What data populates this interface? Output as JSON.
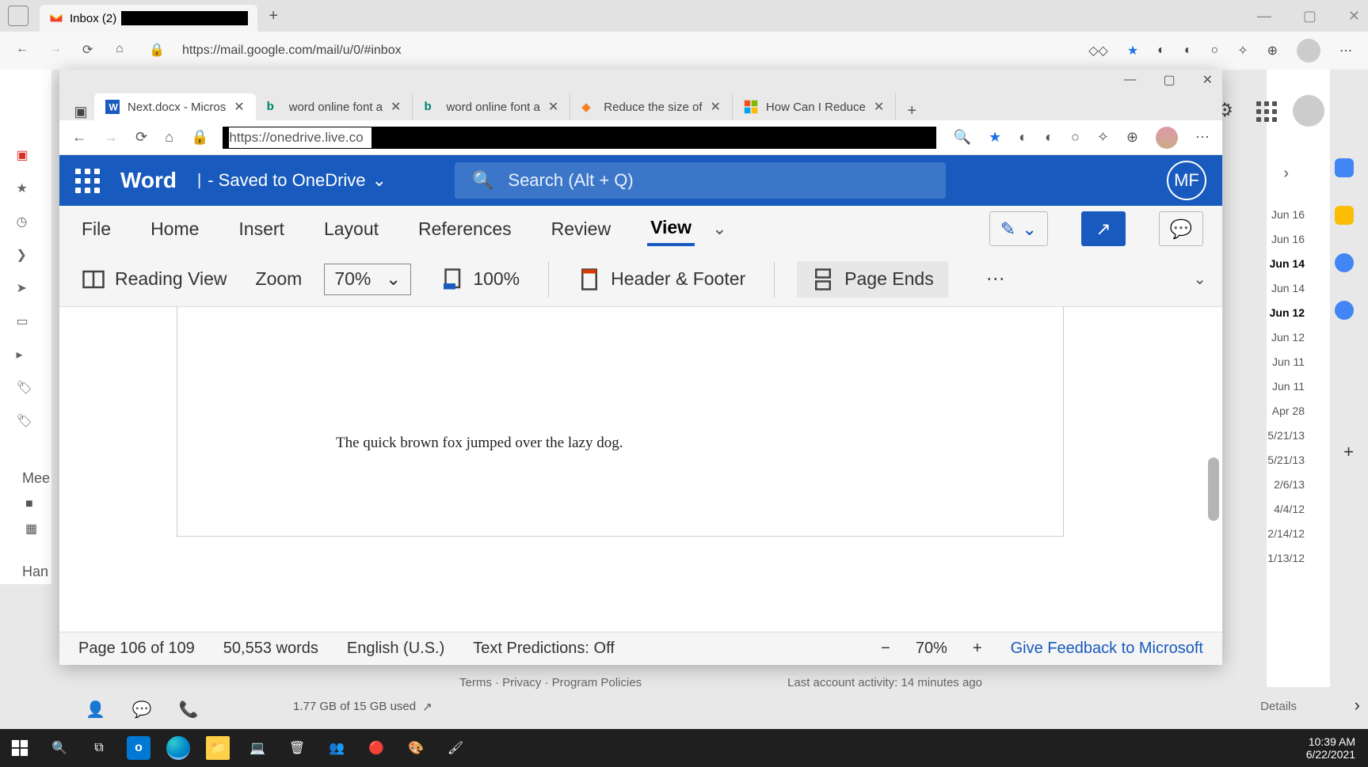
{
  "outer_browser": {
    "tab_label": "Inbox (2)",
    "url": "https://mail.google.com/mail/u/0/#inbox",
    "new_tab_btn": "+"
  },
  "gmail_bg": {
    "compose": "+",
    "meet_label": "Mee",
    "hangouts_label": "Han",
    "dates": [
      "Jun 16",
      "Jun 16",
      "Jun 14",
      "Jun 14",
      "Jun 12",
      "Jun 12",
      "Jun 11",
      "Jun 11",
      "Apr 28",
      "5/21/13",
      "5/21/13",
      "2/6/13",
      "4/4/12",
      "2/14/12",
      "1/13/12"
    ],
    "dates_bold": [
      2,
      4
    ],
    "storage": "1.77 GB of 15 GB used",
    "footer_links": "Terms · Privacy · Program Policies",
    "activity": "Last account activity: 14 minutes ago",
    "details": "Details"
  },
  "inner_edge": {
    "win_minimize": "—",
    "win_maximize": "▢",
    "win_close": "✕",
    "tabs": [
      {
        "label": "Next.docx - Micros",
        "icon": "word",
        "active": true
      },
      {
        "label": "word online font a",
        "icon": "bing"
      },
      {
        "label": "word online font a",
        "icon": "bing"
      },
      {
        "label": "Reduce the size of",
        "icon": "stack"
      },
      {
        "label": "How Can I Reduce",
        "icon": "ms"
      }
    ],
    "url_prefix": "https://onedrive.live.co",
    "menu": "⋯"
  },
  "word": {
    "app_name": "Word",
    "doc_status": "- Saved to OneDrive",
    "search_placeholder": "Search (Alt + Q)",
    "avatar": "MF",
    "tabs": [
      "File",
      "Home",
      "Insert",
      "Layout",
      "References",
      "Review",
      "View"
    ],
    "active_tab": "View",
    "toolbar": {
      "reading_view": "Reading View",
      "zoom_label": "Zoom",
      "zoom_value": "70%",
      "hundred": "100%",
      "header_footer": "Header & Footer",
      "page_ends": "Page Ends"
    },
    "document_text": "The quick brown fox jumped over the lazy dog.",
    "status": {
      "page": "Page 106 of 109",
      "words": "50,553 words",
      "lang": "English (U.S.)",
      "predictions": "Text Predictions: Off",
      "zoom": "70%",
      "feedback": "Give Feedback to Microsoft",
      "minus": "−",
      "plus": "+"
    }
  },
  "taskbar": {
    "time": "10:39 AM",
    "date": "6/22/2021"
  }
}
